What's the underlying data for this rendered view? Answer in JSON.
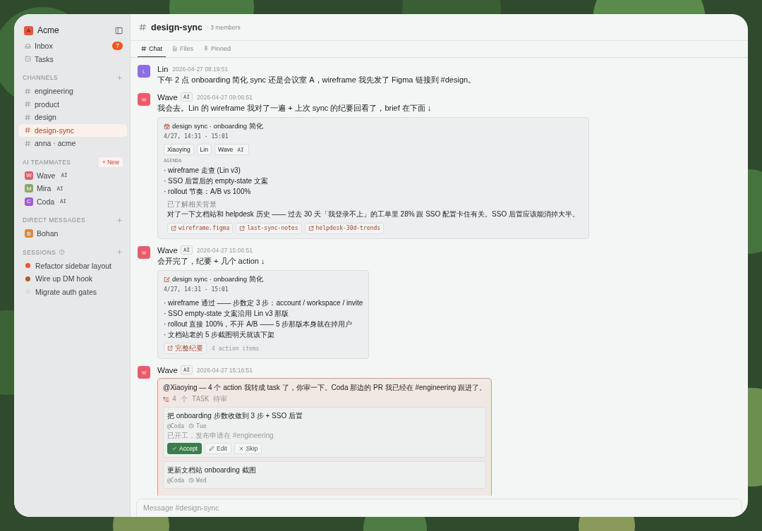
{
  "sidebar": {
    "workspace": {
      "initial": "A",
      "name": "Acme"
    },
    "nav": [
      {
        "kind": "inbox",
        "label": "Inbox",
        "badge": "7"
      },
      {
        "kind": "tasks",
        "label": "Tasks"
      }
    ],
    "sections": [
      {
        "title": "CHANNELS",
        "kind": "channels",
        "items": [
          {
            "label": "engineering",
            "selected": false
          },
          {
            "label": "product",
            "selected": false
          },
          {
            "label": "design",
            "selected": false
          },
          {
            "label": "design-sync",
            "selected": true
          },
          {
            "label": "anna · acme",
            "selected": false
          }
        ]
      },
      {
        "title": "AI TEAMMATES",
        "kind": "people",
        "new_button": "+ New",
        "items": [
          {
            "initial": "W",
            "label": "Wave",
            "tag": "AI",
            "color": "#e35d6f"
          },
          {
            "initial": "M",
            "label": "Mira",
            "tag": "AI",
            "color": "#8da66a"
          },
          {
            "initial": "C",
            "label": "Coda",
            "tag": "AI",
            "color": "#a55bd4"
          }
        ]
      },
      {
        "title": "DIRECT MESSAGES",
        "kind": "people",
        "items": [
          {
            "initial": "B",
            "label": "Bohan",
            "color": "#d88a42"
          }
        ]
      },
      {
        "title": "SESSIONS",
        "kind": "sessions",
        "help": true,
        "items": [
          {
            "label": "Refactor sidebar layout",
            "color": "#f0522c"
          },
          {
            "label": "Wire up DM hook",
            "color": "#b4582d"
          },
          {
            "label": "Migrate auth gates",
            "color": "#dcdfe1"
          }
        ]
      }
    ]
  },
  "channel": {
    "name": "design-sync",
    "meta": "· 3 members",
    "tabs": [
      {
        "kind": "chat",
        "label": "Chat",
        "selected": true
      },
      {
        "kind": "files",
        "label": "Files",
        "selected": false
      },
      {
        "kind": "pinned",
        "label": "Pinned",
        "selected": false
      }
    ],
    "messages": [
      {
        "author": "Lin",
        "initial": "L",
        "color": "#8d6fe2",
        "time": "2026-04-27 08:19:51",
        "text": "下午 2 点 onboarding 简化 sync 还是会议室 A，wireframe 我先发了 Figma 链接到 #design。"
      },
      {
        "author": "Wave",
        "initial": "W",
        "color": "#ea5b6c",
        "tag": "AI",
        "time": "2026-04-27 09:06:51",
        "text": "我会去。Lin 的 wireframe 我对了一遍 + 上次 sync 的纪要回看了，brief 在下面 ↓",
        "card": {
          "kind": "brief",
          "title": "design sync · onboarding 简化",
          "when": "4/27, 14:31 - 15:01",
          "attendees": [
            {
              "name": "Xiaoying"
            },
            {
              "name": "Lin"
            },
            {
              "name": "Wave",
              "tag": "AI"
            }
          ],
          "agenda_label": "AGENDA",
          "agenda": [
            "· wireframe 走查 (Lin v3)",
            "· SSO 后置后的 empty-state 文案",
            "· rollout 节奏：A/B vs 100%"
          ],
          "context_label": "已了解相关背景",
          "context": "对了一下文档站和 helpdesk 历史 —— 过去 30 天「我登录不上」的工单里 28% 跟 SSO 配置卡住有关。SSO 后置应该能消掉大半。",
          "links": [
            "wireframe.figma",
            "last-sync-notes",
            "helpdesk-30d-trends"
          ]
        }
      },
      {
        "author": "Wave",
        "initial": "W",
        "color": "#ea5b6c",
        "tag": "AI",
        "time": "2026-04-27 15:06:51",
        "text": "会开完了，纪要 + 几个 action ↓",
        "card": {
          "kind": "summary",
          "title": "design sync · onboarding 简化",
          "when": "4/27, 14:31 - 15:01",
          "items": [
            "· wireframe 通过 —— 步数定 3 步：account / workspace / invite",
            "· SSO empty-state 文案沿用 Lin v3 那版",
            "· rollout 直接 100%，不开 A/B —— 5 步那版本身就在掉用户",
            "· 文档站老的 5 步截图明天就该下架"
          ],
          "link": "完整纪要",
          "note": "4 action items"
        }
      },
      {
        "author": "Wave",
        "initial": "W",
        "color": "#ea5b6c",
        "tag": "AI",
        "time": "2026-04-27 15:16:51",
        "card": {
          "kind": "tasks",
          "text": "@Xiaoying — 4 个 action 我转成 task 了，你审一下。Coda 那边的 PR 我已经在 #engineering 跟进了。",
          "header": "4 个 TASK 待审",
          "tasks": [
            {
              "title": "把 onboarding 步数收敛到 3 步 + SSO 后置",
              "assignee": "@Coda",
              "due": "Tue",
              "note": "已开工，发布申请在 #engineering",
              "buttons": [
                {
                  "kind": "accept",
                  "label": "Accept"
                },
                {
                  "kind": "edit",
                  "label": "Edit"
                },
                {
                  "kind": "skip",
                  "label": "Skip"
                }
              ]
            },
            {
              "title": "更新文档站 onboarding 截图",
              "assignee": "@Coda",
              "due": "Wed"
            }
          ]
        }
      }
    ],
    "composer": {
      "placeholder": "Message #design-sync"
    }
  }
}
